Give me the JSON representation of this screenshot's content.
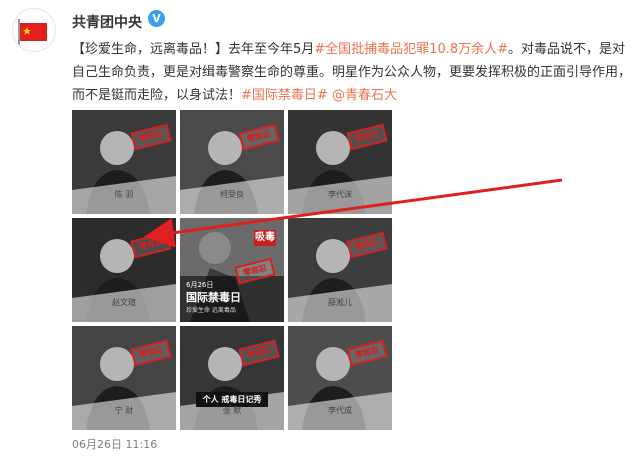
{
  "account": {
    "name": "共青团中央",
    "verified_mark": "V",
    "avatar_icon": "flag-avatar-icon"
  },
  "post": {
    "parts": [
      {
        "text": "【珍爱生命，远离毒品！】去年至今年5月",
        "link": false
      },
      {
        "text": "#全国批捕毒品犯罪10.8万余人#",
        "link": true
      },
      {
        "text": "。对毒品说不，是对自己生命负责，更是对缉毒警察生命的尊重。明星作为公众人物，更要发挥积极的正面引导作用，而不是铤而走险，以身试法！",
        "link": false
      },
      {
        "text": "#国际禁毒日#",
        "link": true
      },
      {
        "text": " ",
        "link": false
      },
      {
        "text": "@青春石大",
        "link": true
      }
    ]
  },
  "grid": {
    "stamp_label": "零容忍",
    "images": [
      {
        "caption": "陈 羽",
        "type": "portrait"
      },
      {
        "caption": "柯受良",
        "type": "portrait"
      },
      {
        "caption": "李代沫",
        "type": "portrait"
      },
      {
        "caption": "赵文瑄",
        "type": "portrait"
      },
      {
        "type": "promo",
        "side_text": "吸毒",
        "date": "6月26日",
        "title": "国际禁毒日",
        "sub": "珍爱生命 远离毒品"
      },
      {
        "caption": "薛淞儿",
        "type": "portrait"
      },
      {
        "caption": "宁 财",
        "type": "portrait"
      },
      {
        "caption": "张 默",
        "type": "portrait",
        "banner": "个人 戒毒日记秀"
      },
      {
        "caption": "李代成",
        "type": "portrait"
      }
    ]
  },
  "timestamp": "06月26日 11:16",
  "colors": {
    "link": "#eb7350",
    "stamp": "#d32020",
    "arrow": "#e02020",
    "badge": "#3b9ef0"
  }
}
